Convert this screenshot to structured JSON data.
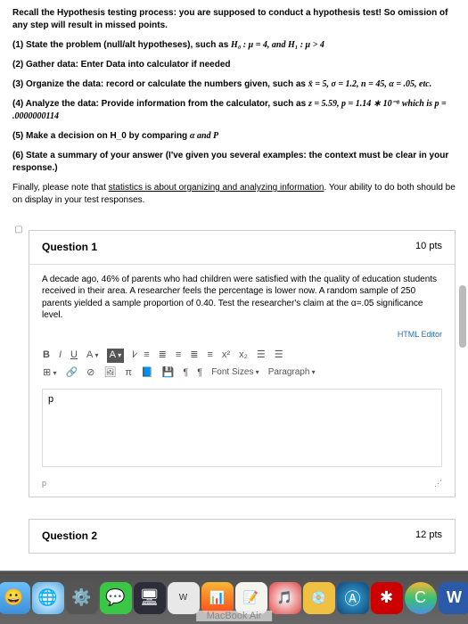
{
  "instructions": {
    "intro": "Recall the Hypothesis testing process: you are supposed to conduct a hypothesis test! So omission of any step will result in missed points.",
    "step1_prefix": "(1) State the problem (null/alt hypotheses), such as ",
    "step1_math": "H₀ : μ = 4, and H₁ : μ > 4",
    "step2": "(2) Gather data: Enter Data into calculator if needed",
    "step3_prefix": "(3) Organize the data: record or calculate the numbers given, such as ",
    "step3_math": "x̄ = 5, σ = 1.2, n = 45, α = .05, etc.",
    "step4_prefix": "(4) Analyze the data: Provide information from the calculator, such as ",
    "step4_math": "z = 5.59, p = 1.14 ∗ 10⁻⁸ which is p = .0000000114",
    "step5_prefix": "(5) Make a decision on H_0 by comparing ",
    "step5_math": "α and P",
    "step6": "(6) State a summary of your answer (I've given you several examples: the context must be clear in your response.)",
    "final_prefix": "Finally, please note that ",
    "final_underline": "statistics is about organizing and analyzing information",
    "final_suffix": ". Your ability to do both should be on display in your test responses."
  },
  "q1": {
    "title": "Question 1",
    "points": "10 pts",
    "body": "A decade ago, 46% of parents who had children were satisfied with the quality of education students received in their area. A researcher feels the percentage is lower now. A random sample of 250 parents yielded a sample proportion of 0.40. Test the researcher's claim at the α=.05 significance level.",
    "html_editor_label": "HTML Editor",
    "editor_text": "p",
    "status_p": "p",
    "toolbar": {
      "bold": "B",
      "italic": "I",
      "underline": "U",
      "fontA": "A",
      "fontA2": "A",
      "Ix": "I̷",
      "alignL": "≡",
      "alignC": "≣",
      "alignR": "≡",
      "alignJ": "≣",
      "indent": "≡",
      "sup": "x²",
      "sub": "x₂",
      "listUl": "☰",
      "listOl": "☰",
      "table": "⊞",
      "link": "🔗",
      "unlink": "⊘",
      "image": "🖼",
      "pi": "π",
      "book": "📘",
      "save": "💾",
      "para1": "¶",
      "para2": "¶",
      "fontsizes": "Font Sizes",
      "paragraph": "Paragraph"
    }
  },
  "q2": {
    "title": "Question 2",
    "points": "12 pts"
  },
  "dock": {
    "finder": "😀",
    "safari": "🌐",
    "settings": "⚙️",
    "messages": "💬",
    "screen": "🖥",
    "word": "W",
    "stats": "📊",
    "notes": "📝",
    "itunes": "🎵",
    "disc": "💿",
    "appstore": "Ⓐ",
    "wolfram": "✱",
    "browser": "C",
    "word2": "W"
  },
  "macbook": "MacBook Air"
}
